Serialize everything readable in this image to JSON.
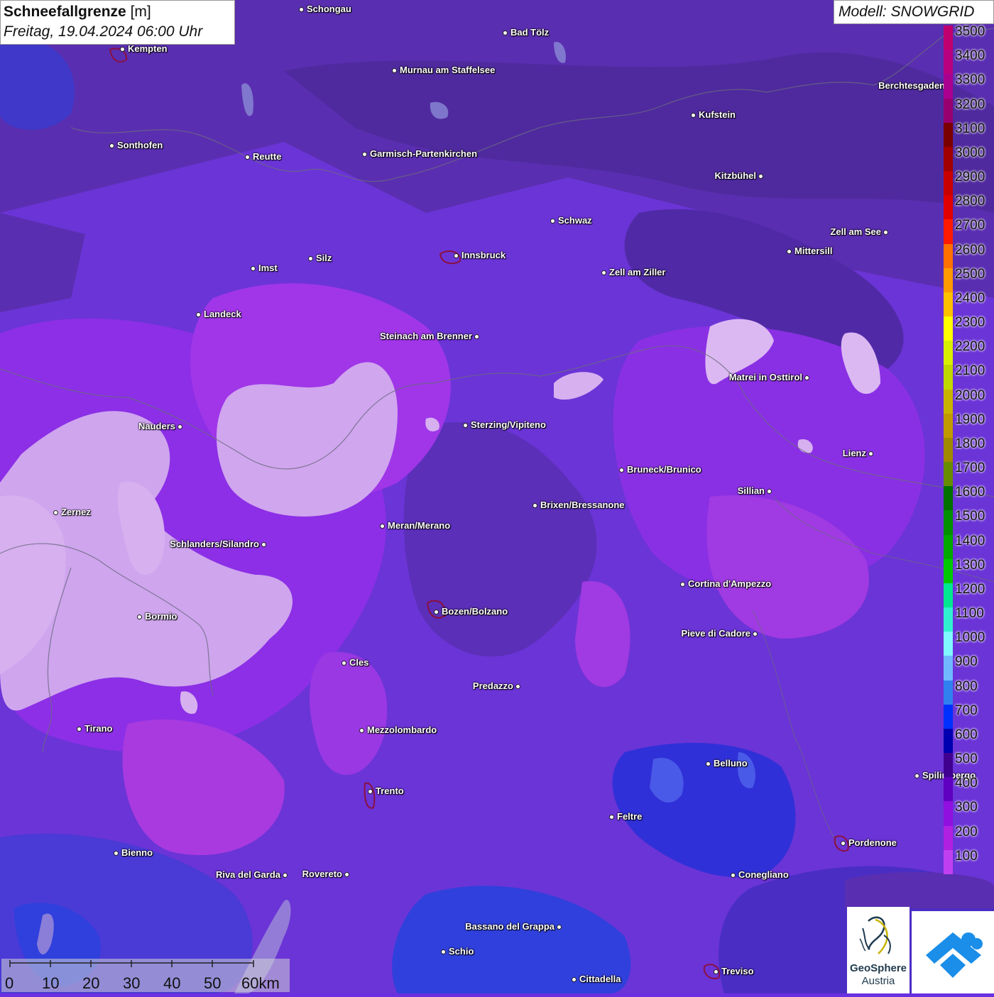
{
  "header": {
    "title_bold": "Schneefallgrenze",
    "title_unit": "[m]",
    "datetime": "Freitag, 19.04.2024 06:00 Uhr",
    "model": "Modell: SNOWGRID"
  },
  "cities": [
    {
      "name": "Schongau",
      "side": "right"
    },
    {
      "name": "Bad Tölz",
      "side": "right"
    },
    {
      "name": "Kempten",
      "side": "right"
    },
    {
      "name": "Murnau am Staffelsee",
      "side": "right"
    },
    {
      "name": "Berchtesgaden",
      "side": "left"
    },
    {
      "name": "Kufstein",
      "side": "right"
    },
    {
      "name": "Sonthofen",
      "side": "right"
    },
    {
      "name": "Reutte",
      "side": "right"
    },
    {
      "name": "Garmisch-Partenkirchen",
      "side": "right"
    },
    {
      "name": "Kitzbühel",
      "side": "left"
    },
    {
      "name": "Schwaz",
      "side": "right"
    },
    {
      "name": "Zell am See",
      "side": "left"
    },
    {
      "name": "Innsbruck",
      "side": "right"
    },
    {
      "name": "Mittersill",
      "side": "right"
    },
    {
      "name": "Imst",
      "side": "right"
    },
    {
      "name": "Silz",
      "side": "right"
    },
    {
      "name": "Zell am Ziller",
      "side": "right"
    },
    {
      "name": "Landeck",
      "side": "right"
    },
    {
      "name": "Steinach am Brenner",
      "side": "left"
    },
    {
      "name": "Matrei in Osttirol",
      "side": "left"
    },
    {
      "name": "Nauders",
      "side": "left"
    },
    {
      "name": "Sterzing/Vipiteno",
      "side": "right"
    },
    {
      "name": "Lienz",
      "side": "left"
    },
    {
      "name": "Bruneck/Brunico",
      "side": "right"
    },
    {
      "name": "Sillian",
      "side": "left"
    },
    {
      "name": "Zernez",
      "side": "right"
    },
    {
      "name": "Brixen/Bressanone",
      "side": "right"
    },
    {
      "name": "Meran/Merano",
      "side": "right"
    },
    {
      "name": "Schlanders/Silandro",
      "side": "left"
    },
    {
      "name": "Cortina d'Ampezzo",
      "side": "right"
    },
    {
      "name": "Bozen/Bolzano",
      "side": "right"
    },
    {
      "name": "Bormio",
      "side": "right"
    },
    {
      "name": "Pieve di Cadore",
      "side": "left"
    },
    {
      "name": "Cles",
      "side": "right"
    },
    {
      "name": "Predazzo",
      "side": "left"
    },
    {
      "name": "Tirano",
      "side": "right"
    },
    {
      "name": "Mezzolombardo",
      "side": "right"
    },
    {
      "name": "Belluno",
      "side": "right"
    },
    {
      "name": "Spilimbergo",
      "side": "right"
    },
    {
      "name": "Trento",
      "side": "right"
    },
    {
      "name": "Feltre",
      "side": "right"
    },
    {
      "name": "Pordenone",
      "side": "right"
    },
    {
      "name": "Bienno",
      "side": "right"
    },
    {
      "name": "Riva del Garda",
      "side": "left"
    },
    {
      "name": "Rovereto",
      "side": "left"
    },
    {
      "name": "Conegliano",
      "side": "right"
    },
    {
      "name": "Bassano del Grappa",
      "side": "left"
    },
    {
      "name": "Schio",
      "side": "right"
    },
    {
      "name": "Treviso",
      "side": "right"
    },
    {
      "name": "Cittadella",
      "side": "right"
    }
  ],
  "legend": {
    "labels": [
      "3500",
      "3400",
      "3300",
      "3200",
      "3100",
      "3000",
      "2900",
      "2800",
      "2700",
      "2600",
      "2500",
      "2400",
      "2300",
      "2200",
      "2100",
      "2000",
      "1900",
      "1800",
      "1700",
      "1600",
      "1500",
      "1400",
      "1300",
      "1200",
      "1100",
      "1000",
      "900",
      "800",
      "700",
      "600",
      "500",
      "400",
      "300",
      "200",
      "100"
    ],
    "colors": [
      "#c0006e",
      "#b80080",
      "#aa0090",
      "#980070",
      "#7a0000",
      "#a00000",
      "#c80000",
      "#e00000",
      "#ff1a00",
      "#ff7000",
      "#ff9a00",
      "#ffc000",
      "#ffff00",
      "#d8f000",
      "#c0d800",
      "#c8b400",
      "#c09a00",
      "#a08800",
      "#688c00",
      "#007000",
      "#009000",
      "#00a800",
      "#00c800",
      "#00e890",
      "#30f0d0",
      "#80f8ff",
      "#70b8ff",
      "#3080f0",
      "#0030ff",
      "#0000b0",
      "#400090",
      "#6000c0",
      "#9010e0",
      "#b020e0",
      "#c040f0"
    ]
  },
  "scale": {
    "labels": [
      "0",
      "10",
      "20",
      "30",
      "40",
      "50",
      "60km"
    ]
  },
  "logos": {
    "geosphere_line1": "GeoSphere",
    "geosphere_line2": "Austria"
  }
}
